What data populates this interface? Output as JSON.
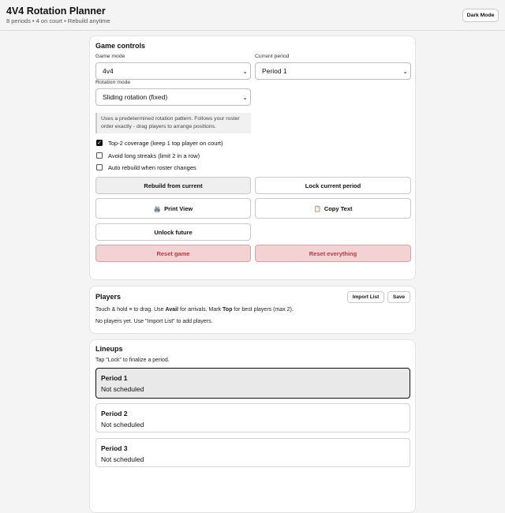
{
  "header": {
    "title": "4V4 Rotation Planner",
    "subtitle": "8 periods • 4 on court • Rebuild anytime",
    "dark_mode_label": "Dark Mode"
  },
  "controls": {
    "title": "Game controls",
    "game_mode_label": "Game mode",
    "game_mode_value": "4v4",
    "current_period_label": "Current period",
    "current_period_value": "Period 1",
    "rotation_mode_label": "Rotation mode",
    "rotation_mode_value": "Sliding rotation (fixed)",
    "info_text": "Uses a predetermined rotation pattern. Follows your roster order exactly - drag players to arrange positions.",
    "checkboxes": [
      {
        "label": "Top-2 coverage (keep 1 top player on court)",
        "checked": true
      },
      {
        "label": "Avoid long streaks (limit 2 in a row)",
        "checked": false
      },
      {
        "label": "Auto rebuild when roster changes",
        "checked": false
      }
    ],
    "rebuild_label": "Rebuild from current",
    "lock_label": "Lock current period",
    "print_label": "Print View",
    "print_icon": "🖨️",
    "copy_label": "Copy Text",
    "copy_icon": "📋",
    "unlock_label": "Unlock future",
    "reset_game_label": "Reset game",
    "reset_all_label": "Reset everything"
  },
  "players": {
    "title": "Players",
    "import_label": "Import List",
    "save_label": "Save",
    "hint_part1": "Touch & hold ≡ to drag. Use ",
    "hint_avail": "Avail",
    "hint_part2": " for arrivals. Mark ",
    "hint_top": "Top",
    "hint_part3": " for best players (max 2).",
    "empty_text": "No players yet. Use \"Import List\" to add players."
  },
  "lineups": {
    "title": "Lineups",
    "hint": "Tap \"Lock\" to finalize a period.",
    "periods": [
      {
        "name": "Period 1",
        "status": "Not scheduled"
      },
      {
        "name": "Period 2",
        "status": "Not scheduled"
      },
      {
        "name": "Period 3",
        "status": "Not scheduled"
      }
    ]
  }
}
